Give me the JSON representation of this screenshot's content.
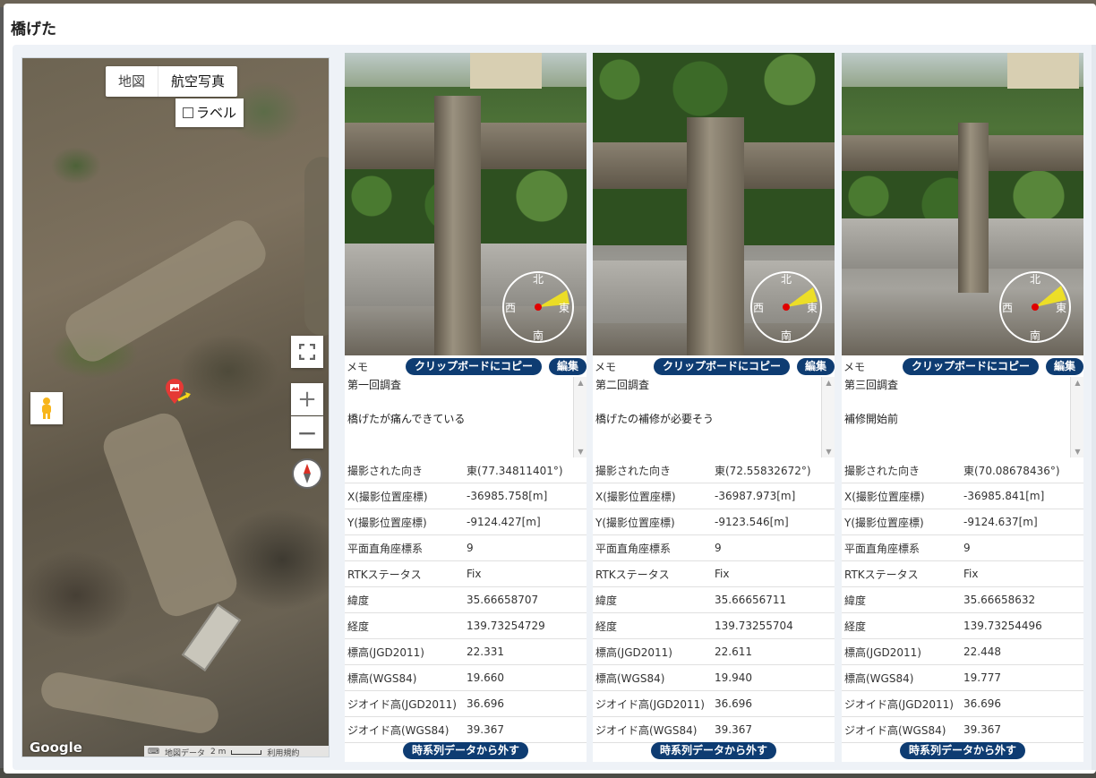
{
  "dialog": {
    "title": "橋げた"
  },
  "map": {
    "type_buttons": [
      "地図",
      "航空写真"
    ],
    "label_toggle": "ラベル",
    "google_logo": "Google",
    "footer": {
      "keyboard": "⌨",
      "data": "地図データ",
      "scale": "2 m",
      "terms": "利用規約"
    }
  },
  "common": {
    "memo_label": "メモ",
    "copy_button": "クリップボードにコピー",
    "edit_button": "編集",
    "remove_button": "時系列データから外す",
    "compass": {
      "n": "北",
      "s": "南",
      "e": "東",
      "w": "西"
    },
    "attr_labels": [
      "撮影された向き",
      "X(撮影位置座標)",
      "Y(撮影位置座標)",
      "平面直角座標系",
      "RTKステータス",
      "緯度",
      "経度",
      "標高(JGD2011)",
      "標高(WGS84)",
      "ジオイド高(JGD2011)",
      "ジオイド高(WGS84)"
    ]
  },
  "photos": [
    {
      "memo_title": "第一回調査",
      "memo_text": "橋げたが痛んできている",
      "values": [
        "東(77.34811401°)",
        "-36985.758[m]",
        "-9124.427[m]",
        "9",
        "Fix",
        "35.66658707",
        "139.73254729",
        "22.331",
        "19.660",
        "36.696",
        "39.367"
      ]
    },
    {
      "memo_title": "第二回調査",
      "memo_text": "橋げたの補修が必要そう",
      "values": [
        "東(72.55832672°)",
        "-36987.973[m]",
        "-9123.546[m]",
        "9",
        "Fix",
        "35.66656711",
        "139.73255704",
        "22.611",
        "19.940",
        "36.696",
        "39.367"
      ]
    },
    {
      "memo_title": "第三回調査",
      "memo_text": "補修開始前",
      "values": [
        "東(70.08678436°)",
        "-36985.841[m]",
        "-9124.637[m]",
        "9",
        "Fix",
        "35.66658632",
        "139.73254496",
        "22.448",
        "19.777",
        "36.696",
        "39.367"
      ]
    }
  ]
}
